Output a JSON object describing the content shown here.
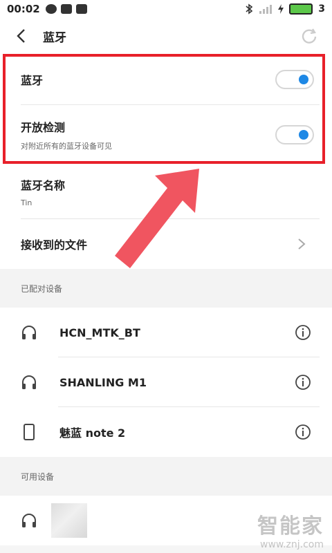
{
  "status_bar": {
    "time": "00:02",
    "battery": "3",
    "battery_color": "#5cc84a"
  },
  "header": {
    "title": "蓝牙"
  },
  "settings": {
    "bluetooth_label": "蓝牙",
    "discoverable_label": "开放检测",
    "discoverable_sub": "对附近所有的蓝牙设备可见",
    "name_label": "蓝牙名称",
    "name_value": "Tin",
    "received_files_label": "接收到的文件"
  },
  "toggles": {
    "bluetooth_on": true,
    "discoverable_on": true,
    "accent": "#1e88e5"
  },
  "paired": {
    "title": "已配对设备",
    "devices": [
      {
        "name": "HCN_MTK_BT",
        "icon": "headphones-icon"
      },
      {
        "name": "SHANLING M1",
        "icon": "headphones-icon"
      },
      {
        "name": "魅蓝 note 2",
        "icon": "phone-icon"
      }
    ]
  },
  "available": {
    "title": "可用设备",
    "devices": [
      {
        "name": "",
        "icon": "headphones-icon"
      }
    ]
  },
  "watermark": {
    "brand": "智能家",
    "url": "www.znj.com"
  },
  "highlight_color": "#e8202a"
}
